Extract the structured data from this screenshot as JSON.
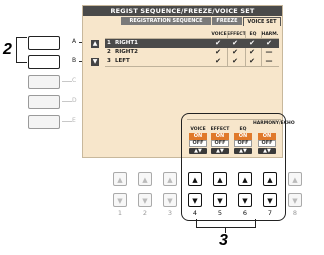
{
  "screen": {
    "title": "REGIST SEQUENCE/FREEZE/VOICE SET",
    "tabs": [
      "REGISTRATION SEQUENCE",
      "FREEZE",
      "VOICE SET"
    ],
    "active_tab": "VOICE SET",
    "columns": [
      "VOICE",
      "EFFECT",
      "EQ",
      "HARM."
    ],
    "rows": [
      {
        "num": "1",
        "name": "RIGHT1",
        "checks": [
          "✔",
          "✔",
          "✔",
          "✔"
        ]
      },
      {
        "num": "2",
        "name": "RIGHT2",
        "checks": [
          "✔",
          "✔",
          "✔",
          "—"
        ]
      },
      {
        "num": "3",
        "name": "LEFT",
        "checks": [
          "✔",
          "✔",
          "✔",
          "—"
        ]
      }
    ],
    "up_icon": "▲",
    "down_icon": "▼",
    "controls": [
      {
        "head": "VOICE",
        "on": "ON",
        "off": "OFF",
        "arrows": "▲▼"
      },
      {
        "head": "EFFECT",
        "on": "ON",
        "off": "OFF",
        "arrows": "▲▼"
      },
      {
        "head": "EQ",
        "on": "ON",
        "off": "OFF",
        "arrows": "▲▼"
      },
      {
        "head": "HARMONY/ECHO",
        "on": "ON",
        "off": "OFF",
        "arrows": "▲▼"
      }
    ]
  },
  "side_buttons": [
    "A",
    "B",
    "C",
    "D",
    "E"
  ],
  "bottom_numbers": [
    "1",
    "2",
    "3",
    "4",
    "5",
    "6",
    "7",
    "8"
  ],
  "callouts": {
    "left": "2",
    "bottom": "3"
  },
  "colors": {
    "screen_bg": "#f7e6cb",
    "on_orange": "#e0792a",
    "dark": "#4a4a4a"
  }
}
